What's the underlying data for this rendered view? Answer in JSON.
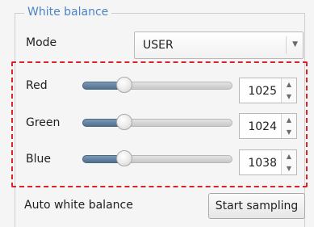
{
  "group": {
    "title": "White balance"
  },
  "mode": {
    "label": "Mode",
    "selected": "USER",
    "dropdown_icon": "chevron-down-icon"
  },
  "channels": [
    {
      "label": "Red",
      "value": "1025",
      "slider_fraction": 0.25
    },
    {
      "label": "Green",
      "value": "1024",
      "slider_fraction": 0.25
    },
    {
      "label": "Blue",
      "value": "1038",
      "slider_fraction": 0.25
    }
  ],
  "auto_wb": {
    "label": "Auto white balance",
    "button_label": "Start sampling"
  },
  "colors": {
    "group_title": "#4a84c4",
    "highlight_border": "#d9242a",
    "slider_fill": "#4f708f"
  }
}
